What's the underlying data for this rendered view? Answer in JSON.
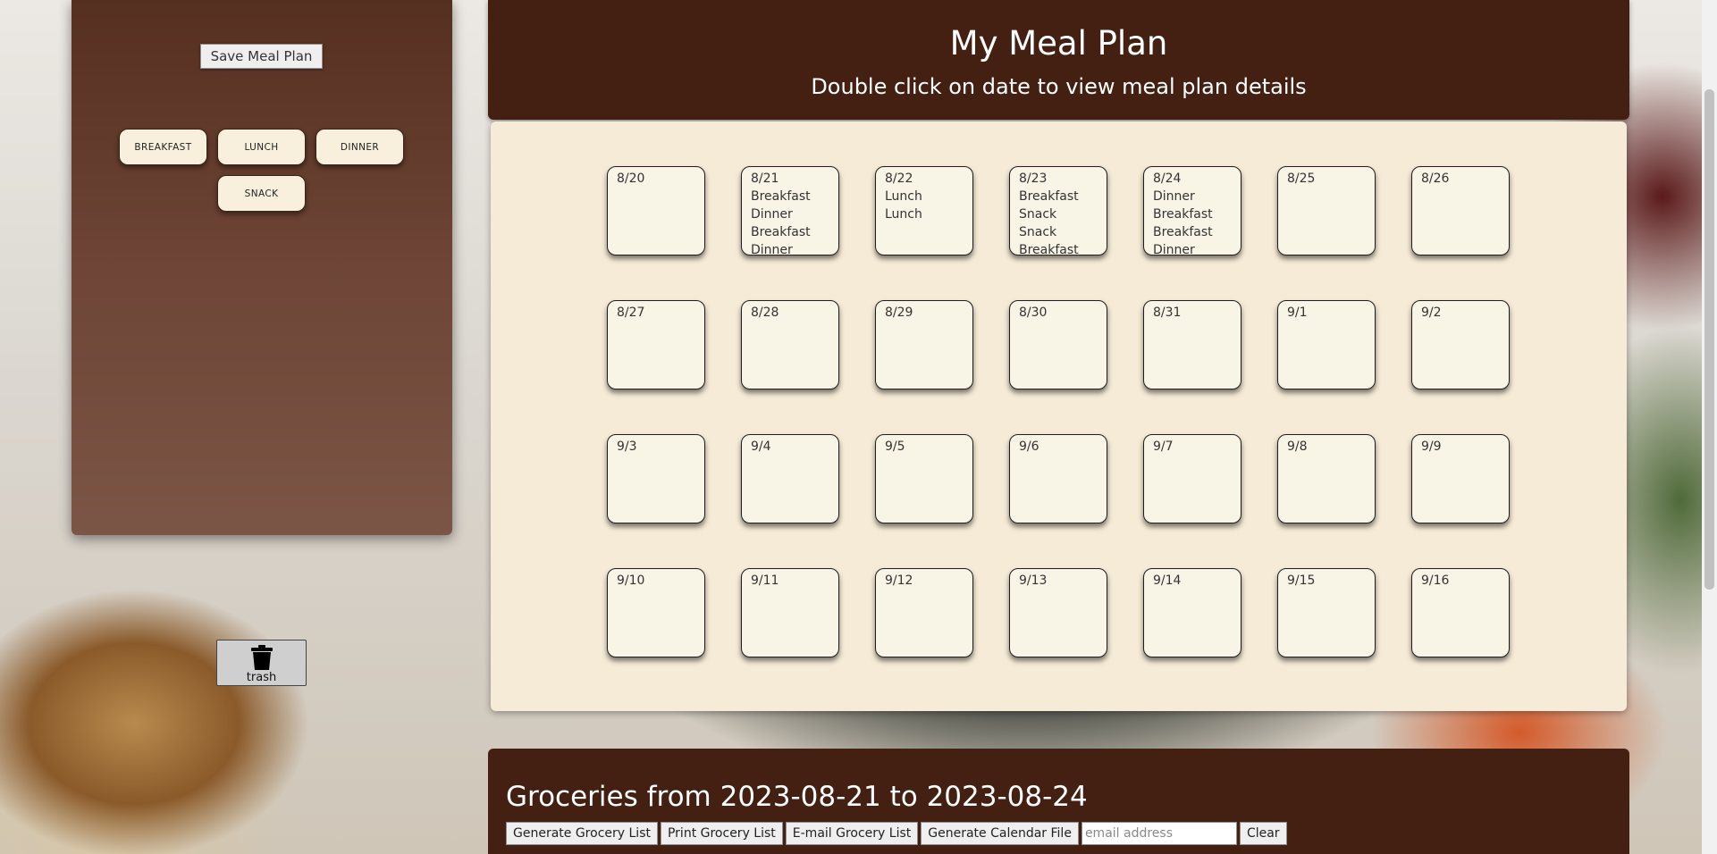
{
  "sidebar": {
    "save_label": "Save Meal Plan",
    "meals": [
      "BREAKFAST",
      "LUNCH",
      "DINNER",
      "SNACK"
    ],
    "trash_label": "trash"
  },
  "header": {
    "title": "My Meal Plan",
    "subtitle": "Double click on date to view meal plan details"
  },
  "calendar": {
    "weeks": [
      [
        {
          "date": "8/20",
          "meals": []
        },
        {
          "date": "8/21",
          "meals": [
            "Breakfast",
            "Dinner",
            "Breakfast",
            "Dinner"
          ]
        },
        {
          "date": "8/22",
          "meals": [
            "Lunch",
            "Lunch"
          ]
        },
        {
          "date": "8/23",
          "meals": [
            "Breakfast",
            "Snack",
            "Snack",
            "Breakfast"
          ]
        },
        {
          "date": "8/24",
          "meals": [
            "Dinner",
            "Breakfast",
            "Breakfast",
            "Dinner"
          ]
        },
        {
          "date": "8/25",
          "meals": []
        },
        {
          "date": "8/26",
          "meals": []
        }
      ],
      [
        {
          "date": "8/27",
          "meals": []
        },
        {
          "date": "8/28",
          "meals": []
        },
        {
          "date": "8/29",
          "meals": []
        },
        {
          "date": "8/30",
          "meals": []
        },
        {
          "date": "8/31",
          "meals": []
        },
        {
          "date": "9/1",
          "meals": []
        },
        {
          "date": "9/2",
          "meals": []
        }
      ],
      [
        {
          "date": "9/3",
          "meals": []
        },
        {
          "date": "9/4",
          "meals": []
        },
        {
          "date": "9/5",
          "meals": []
        },
        {
          "date": "9/6",
          "meals": []
        },
        {
          "date": "9/7",
          "meals": []
        },
        {
          "date": "9/8",
          "meals": []
        },
        {
          "date": "9/9",
          "meals": []
        }
      ],
      [
        {
          "date": "9/10",
          "meals": []
        },
        {
          "date": "9/11",
          "meals": []
        },
        {
          "date": "9/12",
          "meals": []
        },
        {
          "date": "9/13",
          "meals": []
        },
        {
          "date": "9/14",
          "meals": []
        },
        {
          "date": "9/15",
          "meals": []
        },
        {
          "date": "9/16",
          "meals": []
        }
      ]
    ]
  },
  "groceries": {
    "title": "Groceries from 2023-08-21 to 2023-08-24",
    "generate_label": "Generate Grocery List",
    "print_label": "Print Grocery List",
    "email_label": "E-mail Grocery List",
    "calendar_label": "Generate Calendar File",
    "email_placeholder": "email address",
    "clear_label": "Clear"
  },
  "icons": {
    "trash": "trash-icon"
  }
}
